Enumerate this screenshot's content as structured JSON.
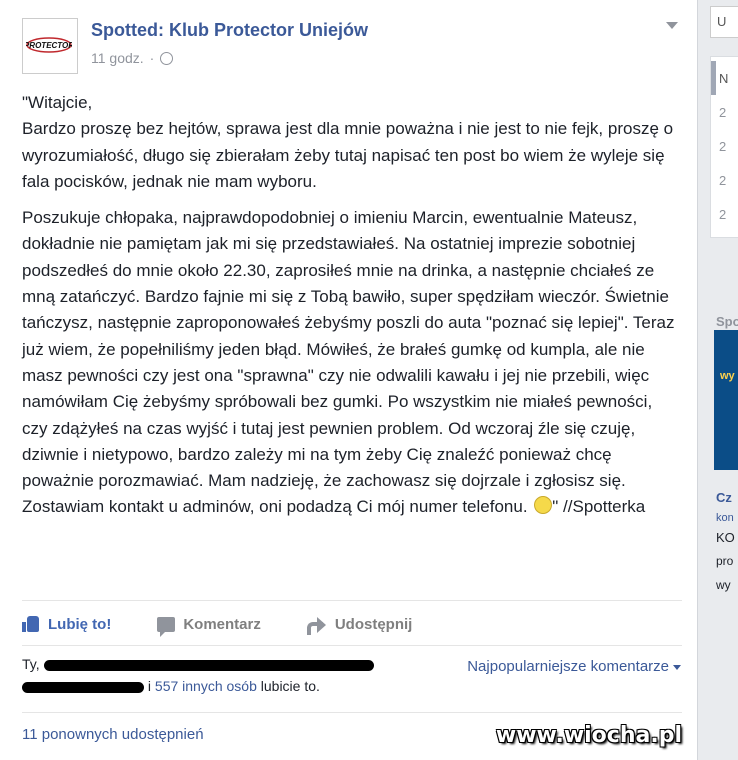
{
  "post": {
    "page_name": "Spotted: Klub Protector Uniejów",
    "time": "11 godz.",
    "separator": "·",
    "logo_text": "PROTECTOR",
    "paragraph1": "\"Witajcie,\nBardzo proszę bez hejtów, sprawa jest dla mnie poważna i nie jest to nie fejk, proszę o wyrozumiałość, długo się zbierałam żeby tutaj napisać ten post bo wiem że wyleje się fala pocisków, jednak nie mam wyboru.",
    "paragraph2": "Poszukuje chłopaka, najprawdopodobniej o imieniu Marcin, ewentualnie Mateusz, dokładnie nie pamiętam jak mi się przedstawiałeś. Na ostatniej imprezie sobotniej podszedłeś do mnie około 22.30, zaprosiłeś mnie na drinka, a następnie chciałeś ze mną zatańczyć. Bardzo fajnie mi się z Tobą bawiło, super spędziłam wieczór. Świetnie tańczysz, następnie zaproponowałeś żebyśmy poszli do auta \"poznać się lepiej\". Teraz już wiem, że popełniliśmy jeden błąd. Mówiłeś, że brałeś gumkę od kumpla, ale nie masz pewności czy jest ona \"sprawna\" czy nie odwalili kawału i jej nie przebili, więc namówiłam Cię żebyśmy spróbowali bez gumki. Po wszystkim nie miałeś pewności, czy zdążyłeś na czas wyjść i tutaj jest pewnien problem. Od wczoraj źle się czuję, dziwnie i nietypowo, bardzo zależy mi na tym żeby Cię znaleźć ponieważ chcę poważnie porozmawiać. Mam nadzieję, że zachowasz się dojrzale i zgłosisz się. Zostawiam kontakt u adminów, oni podadzą Ci mój numer telefonu.",
    "paragraph2_end": "\" //Spotterka"
  },
  "actions": {
    "like": "Lubię to!",
    "comment": "Komentarz",
    "share": "Udostępnij"
  },
  "likes": {
    "prefix": "Ty,",
    "others_link": "557 innych osób",
    "joiner": "i",
    "suffix": "lubicie to."
  },
  "comments_sort": "Najpopularniejsze komentarze",
  "shares": "11 ponownych udostępnień",
  "watermark": "www.wiocha.pl",
  "sidebar": {
    "search_partial": "U",
    "items": [
      "N",
      "2",
      "2",
      "2",
      "2"
    ],
    "section_label": "Spo",
    "ad_text": "wy",
    "texts": [
      "Cz",
      "kon",
      "KO",
      "pro",
      "wy"
    ]
  }
}
